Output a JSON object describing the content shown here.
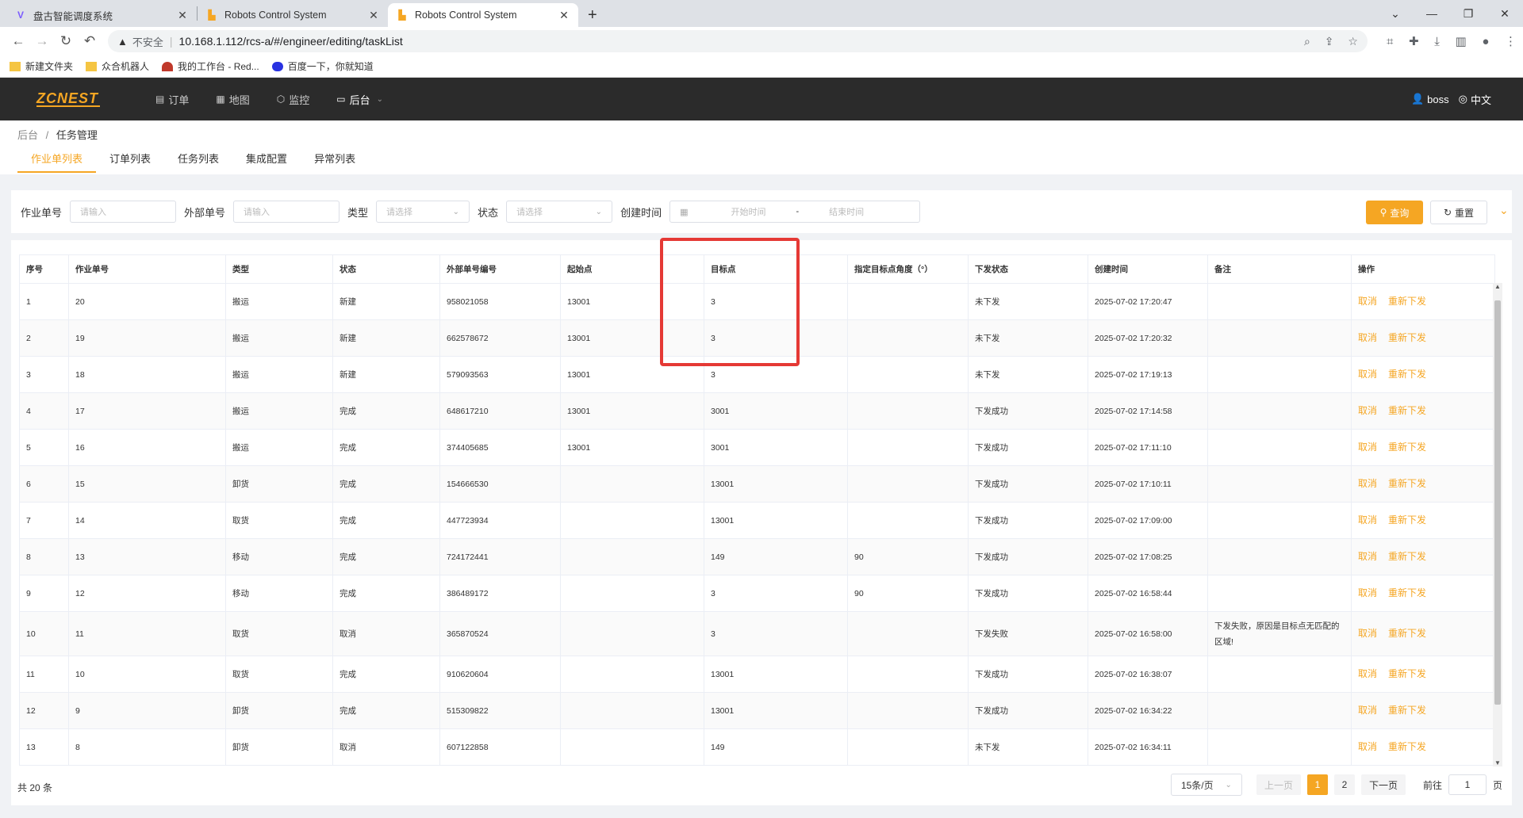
{
  "browser": {
    "tabs": [
      {
        "title": "盘古智能调度系统",
        "icon": "V",
        "icon_color": "#7b5cff",
        "active": false
      },
      {
        "title": "Robots Control System",
        "icon": "R",
        "icon_color": "#f5a623",
        "active": false
      },
      {
        "title": "Robots Control System",
        "icon": "R",
        "icon_color": "#f5a623",
        "active": true
      }
    ],
    "new_tab": "+",
    "insecure_label": "不安全",
    "url": "10.168.1.112/rcs-a/#/engineer/editing/taskList",
    "bookmarks": [
      {
        "label": "新建文件夹"
      },
      {
        "label": "众合机器人"
      },
      {
        "label": "我的工作台 - Red..."
      },
      {
        "label": "百度一下，你就知道"
      }
    ]
  },
  "app": {
    "logo": "ZCNEST",
    "nav": [
      {
        "label": "订单",
        "icon": "document-icon"
      },
      {
        "label": "地图",
        "icon": "map-icon"
      },
      {
        "label": "监控",
        "icon": "monitor-icon"
      },
      {
        "label": "后台",
        "icon": "desktop-icon"
      }
    ],
    "user": "boss",
    "language": "中文",
    "accent": "#f5a623"
  },
  "breadcrumb": {
    "root": "后台",
    "sep": "/",
    "current": "任务管理"
  },
  "subtabs": [
    "作业单列表",
    "订单列表",
    "任务列表",
    "集成配置",
    "异常列表"
  ],
  "filter": {
    "job_no_label": "作业单号",
    "job_no_placeholder": "请输入",
    "ext_no_label": "外部单号",
    "ext_no_placeholder": "请输入",
    "type_label": "类型",
    "type_placeholder": "请选择",
    "status_label": "状态",
    "status_placeholder": "请选择",
    "created_label": "创建时间",
    "start_placeholder": "开始时间",
    "range_sep": "-",
    "end_placeholder": "结束时间",
    "query": "查询",
    "reset": "重置"
  },
  "table": {
    "headers": [
      "序号",
      "作业单号",
      "类型",
      "状态",
      "外部单号编号",
      "起始点",
      "目标点",
      "指定目标点角度（°）",
      "下发状态",
      "创建时间",
      "备注",
      "操作"
    ],
    "rows": [
      [
        "1",
        "20",
        "搬运",
        "新建",
        "958021058",
        "13001",
        "3",
        "",
        "未下发",
        "2025-07-02 17:20:47",
        ""
      ],
      [
        "2",
        "19",
        "搬运",
        "新建",
        "662578672",
        "13001",
        "3",
        "",
        "未下发",
        "2025-07-02 17:20:32",
        ""
      ],
      [
        "3",
        "18",
        "搬运",
        "新建",
        "579093563",
        "13001",
        "3",
        "",
        "未下发",
        "2025-07-02 17:19:13",
        ""
      ],
      [
        "4",
        "17",
        "搬运",
        "完成",
        "648617210",
        "13001",
        "3001",
        "",
        "下发成功",
        "2025-07-02 17:14:58",
        ""
      ],
      [
        "5",
        "16",
        "搬运",
        "完成",
        "374405685",
        "13001",
        "3001",
        "",
        "下发成功",
        "2025-07-02 17:11:10",
        ""
      ],
      [
        "6",
        "15",
        "卸货",
        "完成",
        "154666530",
        "",
        "13001",
        "",
        "下发成功",
        "2025-07-02 17:10:11",
        ""
      ],
      [
        "7",
        "14",
        "取货",
        "完成",
        "447723934",
        "",
        "13001",
        "",
        "下发成功",
        "2025-07-02 17:09:00",
        ""
      ],
      [
        "8",
        "13",
        "移动",
        "完成",
        "724172441",
        "",
        "149",
        "90",
        "下发成功",
        "2025-07-02 17:08:25",
        ""
      ],
      [
        "9",
        "12",
        "移动",
        "完成",
        "386489172",
        "",
        "3",
        "90",
        "下发成功",
        "2025-07-02 16:58:44",
        ""
      ],
      [
        "10",
        "11",
        "取货",
        "取消",
        "365870524",
        "",
        "3",
        "",
        "下发失败",
        "2025-07-02 16:58:00",
        "下发失败，原因是目标点无匹配的区域!"
      ],
      [
        "11",
        "10",
        "取货",
        "完成",
        "910620604",
        "",
        "13001",
        "",
        "下发成功",
        "2025-07-02 16:38:07",
        ""
      ],
      [
        "12",
        "9",
        "卸货",
        "完成",
        "515309822",
        "",
        "13001",
        "",
        "下发成功",
        "2025-07-02 16:34:22",
        ""
      ],
      [
        "13",
        "8",
        "卸货",
        "取消",
        "607122858",
        "",
        "149",
        "",
        "未下发",
        "2025-07-02 16:34:11",
        ""
      ]
    ],
    "actions": {
      "cancel": "取消",
      "resend": "重新下发"
    }
  },
  "pagination": {
    "total": "共 20 条",
    "page_size": "15条/页",
    "prev": "上一页",
    "pages": [
      "1",
      "2"
    ],
    "current_page": "1",
    "next": "下一页",
    "goto_label": "前往",
    "goto_value": "1",
    "goto_suffix": "页"
  }
}
